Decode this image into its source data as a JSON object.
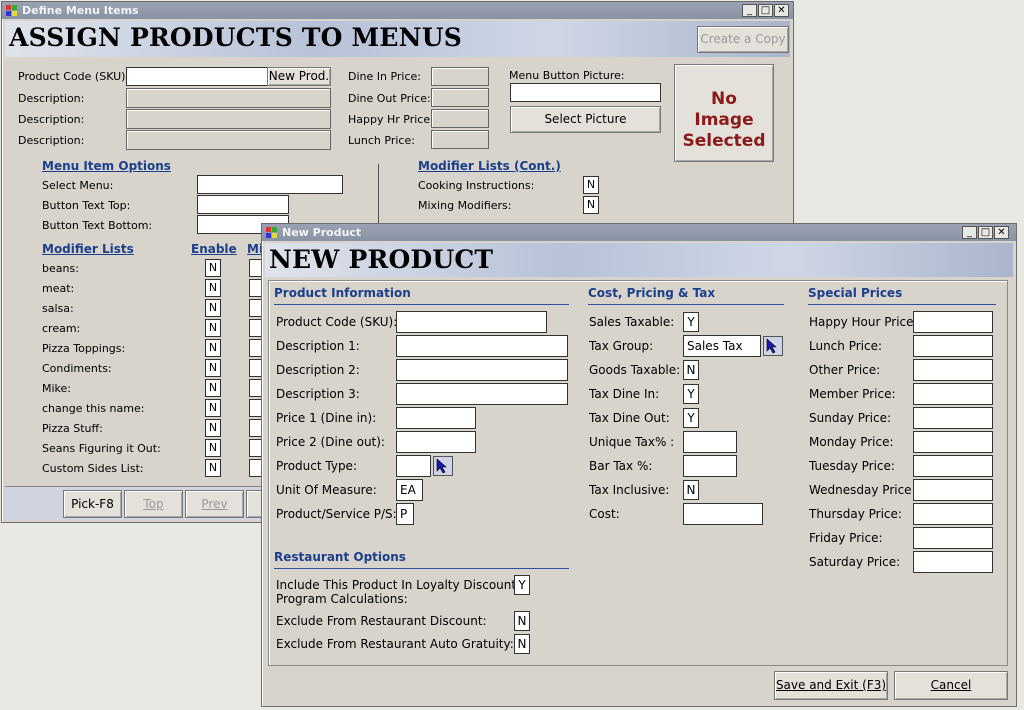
{
  "back": {
    "title": "Define Menu Items",
    "heading": "ASSIGN PRODUCTS TO MENUS",
    "create_copy": "Create a Copy",
    "labels": {
      "product_code": "Product Code (SKU):",
      "description": "Description:",
      "new_prod": "New Prod.",
      "dine_in": "Dine In Price:",
      "dine_out": "Dine Out Price:",
      "happy_hr": "Happy Hr Price:",
      "lunch": "Lunch Price:",
      "menu_button_picture": "Menu Button Picture:",
      "select_picture": "Select Picture",
      "no_image": "No Image Selected"
    },
    "menu_item_options": {
      "header": "Menu Item Options",
      "select_menu": "Select Menu:",
      "button_text_top": "Button Text Top:",
      "button_text_bottom": "Button Text Bottom:"
    },
    "modifier_cont": {
      "header": "Modifier Lists (Cont.)",
      "cooking": "Cooking Instructions:",
      "cooking_val": "N",
      "mixing": "Mixing Modifiers:",
      "mixing_val": "N"
    },
    "modifier_lists": {
      "header": "Modifier Lists",
      "enable": "Enable",
      "min_partial": "Mi",
      "items": [
        {
          "name": "beans:",
          "val": "N"
        },
        {
          "name": "meat:",
          "val": "N"
        },
        {
          "name": "salsa:",
          "val": "N"
        },
        {
          "name": "cream:",
          "val": "N"
        },
        {
          "name": "Pizza Toppings:",
          "val": "N"
        },
        {
          "name": "Condiments:",
          "val": "N"
        },
        {
          "name": "Mike:",
          "val": "N"
        },
        {
          "name": "change this name:",
          "val": "N"
        },
        {
          "name": "Pizza Stuff:",
          "val": "N"
        },
        {
          "name": "Seans Figuring it Out:",
          "val": "N"
        },
        {
          "name": "Custom Sides List:",
          "val": "N"
        }
      ]
    },
    "nav": {
      "pick": "Pick-F8",
      "top": "Top",
      "prev": "Prev"
    }
  },
  "front": {
    "title": "New Product",
    "heading": "NEW PRODUCT",
    "product_info": {
      "header": "Product Information",
      "product_code": "Product Code (SKU):",
      "desc1": "Description 1:",
      "desc2": "Description 2:",
      "desc3": "Description 3:",
      "price1": "Price 1 (Dine in):",
      "price2": "Price 2 (Dine out):",
      "product_type": "Product Type:",
      "unit": "Unit Of Measure:",
      "unit_val": "EA",
      "ps": "Product/Service P/S:",
      "ps_val": "P"
    },
    "cost_tax": {
      "header": "Cost, Pricing & Tax",
      "sales_taxable": "Sales Taxable:",
      "sales_taxable_val": "Y",
      "tax_group": "Tax Group:",
      "tax_group_val": "Sales Tax",
      "goods_taxable": "Goods Taxable:",
      "goods_taxable_val": "N",
      "tax_dine_in": "Tax Dine In:",
      "tax_dine_in_val": "Y",
      "tax_dine_out": "Tax Dine Out:",
      "tax_dine_out_val": "Y",
      "unique_tax": "Unique Tax% :",
      "bar_tax": "Bar Tax %:",
      "tax_inclusive": "Tax Inclusive:",
      "tax_inclusive_val": "N",
      "cost": "Cost:"
    },
    "special_prices": {
      "header": "Special Prices",
      "items": [
        "Happy Hour Price:",
        "Lunch Price:",
        "Other Price:",
        "Member Price:",
        "Sunday Price:",
        "Monday Price:",
        "Tuesday Price:",
        "Wednesday Price:",
        "Thursday Price:",
        "Friday Price:",
        "Saturday Price:"
      ]
    },
    "restaurant": {
      "header": "Restaurant Options",
      "loyalty_line1": "Include This Product In Loyalty Discount",
      "loyalty_line2": "Program Calculations:",
      "loyalty_val": "Y",
      "exclude_discount": "Exclude From Restaurant Discount:",
      "exclude_discount_val": "N",
      "exclude_gratuity": "Exclude From Restaurant Auto Gratuity:",
      "exclude_gratuity_val": "N"
    },
    "save": "Save and Exit (F3)",
    "cancel": "Cancel"
  }
}
